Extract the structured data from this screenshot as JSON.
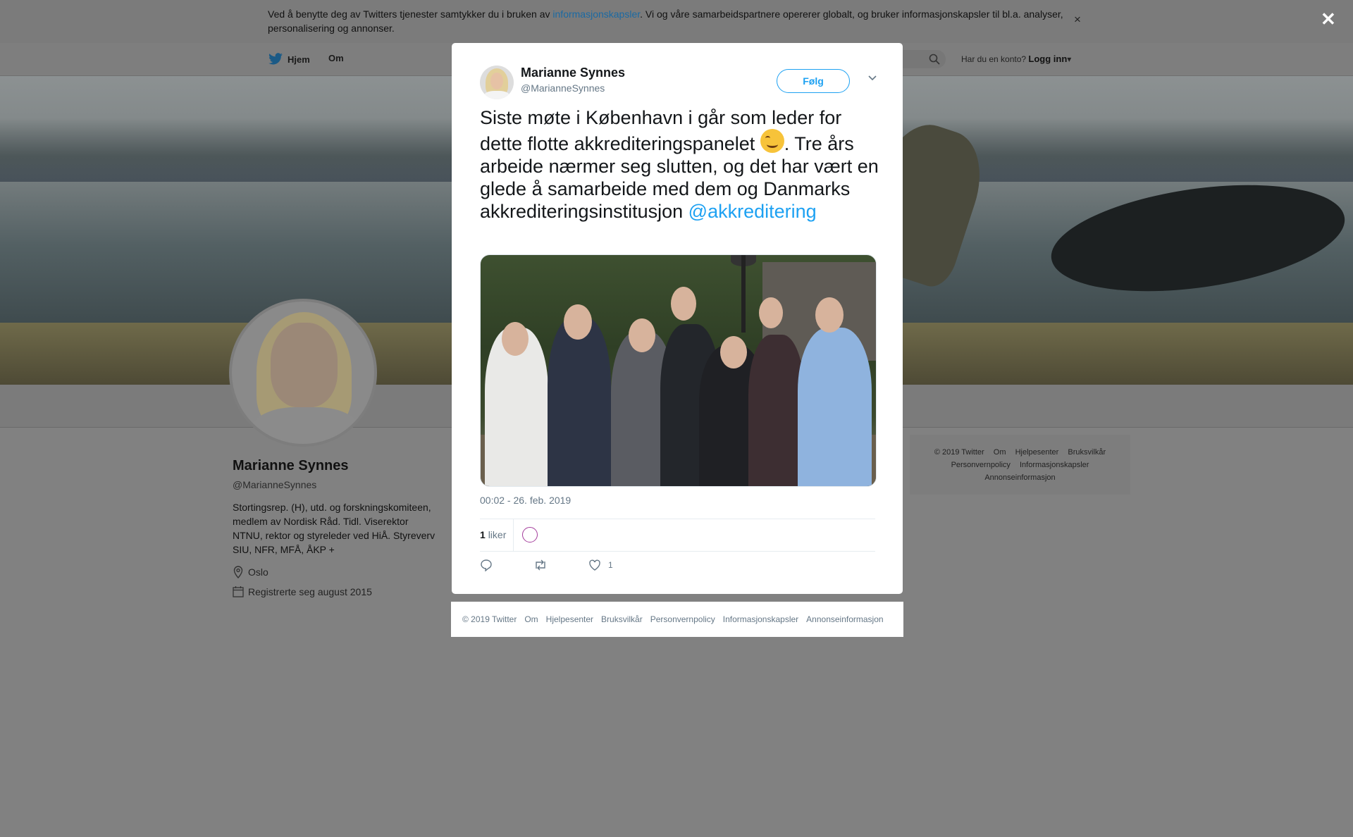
{
  "cookie_banner": {
    "text_before": "Ved å benytte deg av Twitters tjenester samtykker du i bruken av ",
    "link": "informasjonskapsler",
    "text_after": ". Vi og våre samarbeidspartnere opererer globalt, og bruker informasjonskapsler til bl.a. analyser, personalisering og annonser.",
    "close_label": "×"
  },
  "nav": {
    "home": "Hjem",
    "about": "Om",
    "login_prompt": "Har du en konto?",
    "login": "Logg inn"
  },
  "profile": {
    "name": "Marianne Synnes",
    "handle": "@MarianneSynnes",
    "bio": "Stortingsrep. (H), utd. og forskningskomiteen, medlem av Nordisk Råd. Tidl. Viserektor NTNU, rektor og styreleder ved HiÅ. Styreverv SIU, NFR, MFÅ, ÅKP +",
    "location": "Oslo",
    "joined": "Registrerte seg august 2015"
  },
  "right_footer": {
    "links": [
      "© 2019 Twitter",
      "Om",
      "Hjelpesenter",
      "Bruksvilkår",
      "Personvernpolicy",
      "Informasjonskapsler",
      "Annonseinformasjon"
    ]
  },
  "tweet": {
    "author_name": "Marianne Synnes",
    "author_handle": "@MarianneSynnes",
    "follow_label": "Følg",
    "text_part1": "Siste møte i København i går som leder for dette flotte akkrediteringspanelet ",
    "text_part2": ". Tre års arbeide nærmer seg slutten, og det har vært en glede å samarbeide med dem og Danmarks akkrediteringsinstitusjon ",
    "mention": "@akkreditering",
    "timestamp": "00:02 - 26. feb. 2019",
    "likes_count": "1",
    "likes_label": "liker",
    "like_action_count": "1"
  },
  "modal_footer": {
    "links": [
      "© 2019 Twitter",
      "Om",
      "Hjelpesenter",
      "Bruksvilkår",
      "Personvernpolicy",
      "Informasjonskapsler",
      "Annonseinformasjon"
    ]
  },
  "overlay_close": "✕",
  "colors": {
    "accent": "#1da1f2",
    "overlay": "#808080"
  }
}
